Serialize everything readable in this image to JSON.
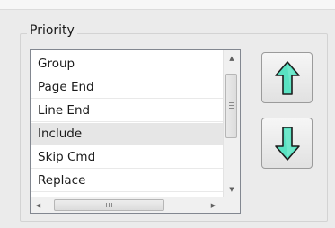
{
  "priority_group": {
    "title": "Priority"
  },
  "list": {
    "items": [
      {
        "label": "Group",
        "selected": false
      },
      {
        "label": "Page End",
        "selected": false
      },
      {
        "label": "Line End",
        "selected": false
      },
      {
        "label": "Include",
        "selected": true
      },
      {
        "label": "Skip Cmd",
        "selected": false
      },
      {
        "label": "Replace",
        "selected": false
      }
    ]
  },
  "buttons": {
    "move_up_icon": "up-arrow-icon",
    "move_down_icon": "down-arrow-icon",
    "arrow_color": "#59e2c2"
  }
}
